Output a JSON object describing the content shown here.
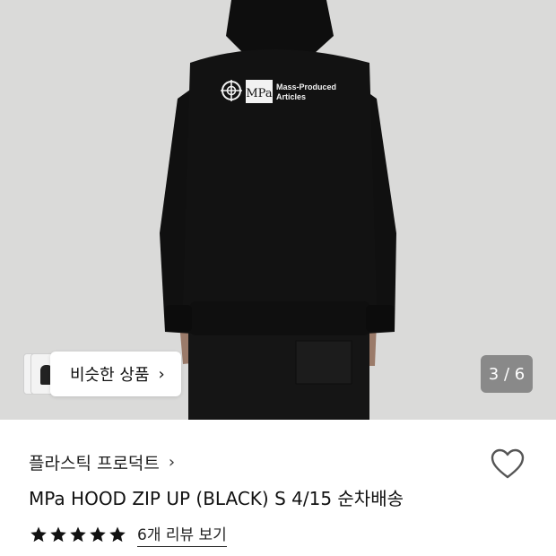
{
  "gallery": {
    "counter": "3 / 6",
    "similar_button": {
      "label": "비슷한 상품",
      "chevron": "chevron-right-icon"
    },
    "print": {
      "logo_text": "MPa",
      "tagline_1": "Mass-Produced",
      "tagline_2": "Articles"
    }
  },
  "product": {
    "brand": "플라스틱 프로덕트",
    "brand_chevron": "chevron-right-icon",
    "title": "MPa HOOD ZIP UP (BLACK) S 4/15 순차배송",
    "rating": 5,
    "review_link": "6개 리뷰 보기",
    "like_icon": "heart-outline-icon"
  }
}
